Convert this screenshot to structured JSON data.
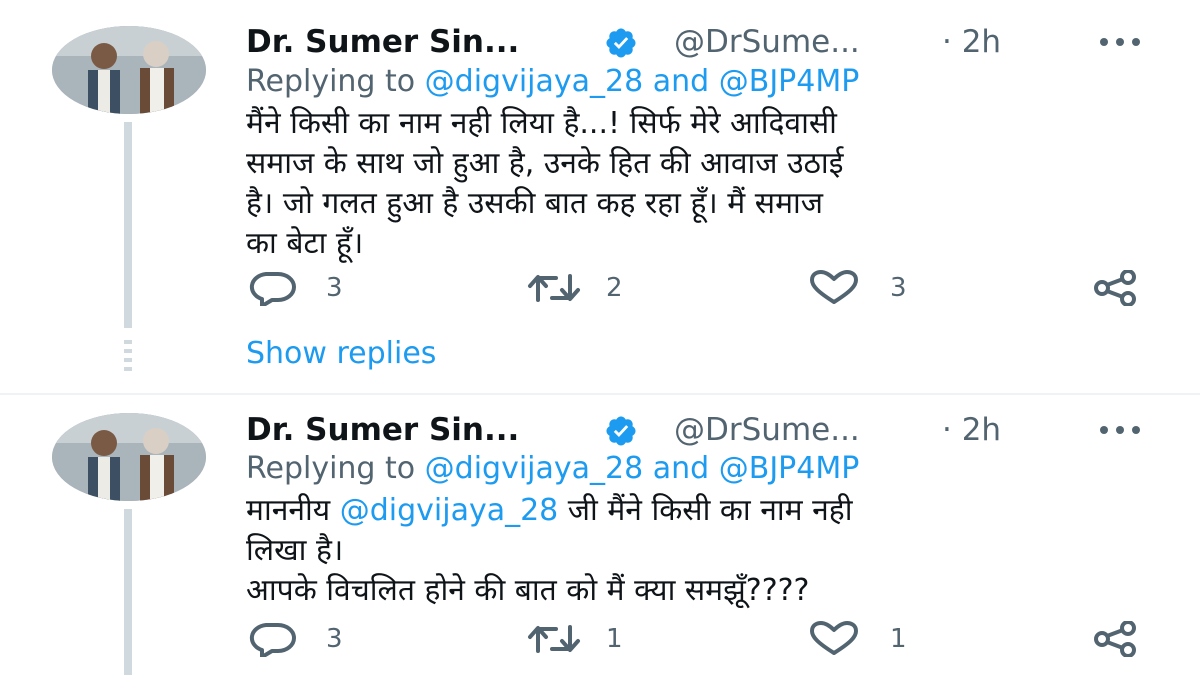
{
  "tweets": [
    {
      "author_name": "Dr. Sumer Sin...",
      "handle": "@DrSume...",
      "time": "· 2h",
      "replying_prefix": "Replying to ",
      "replying_handle_1": "@digvijaya_28",
      "replying_and": " and ",
      "replying_handle_2": "@BJP4MP",
      "text_lines": [
        "मैंने किसी का नाम नही लिया है...! सिर्फ मेरे आदिवासी",
        "समाज के साथ जो हुआ है, उनके हित की आवाज उठाई",
        "है। जो गलत हुआ है उसकी बात कह रहा हूँ। मैं समाज",
        "का बेटा हूँ।"
      ],
      "replies": "3",
      "retweets": "2",
      "likes": "3"
    },
    {
      "author_name": "Dr. Sumer Sin...",
      "handle": "@DrSume...",
      "time": "· 2h",
      "replying_prefix": "Replying to ",
      "replying_handle_1": "@digvijaya_28",
      "replying_and": " and ",
      "replying_handle_2": "@BJP4MP",
      "mention_prefix": "माननीय ",
      "mention": "@digvijaya_28",
      "mention_suffix": " जी  मैंने किसी का नाम नही",
      "text_lines": [
        "लिखा है।",
        "आपके  विचलित होने की बात को मैं क्या समझूँ????"
      ],
      "replies": "3",
      "retweets": "1",
      "likes": "1"
    }
  ],
  "show_replies": "Show replies",
  "colors": {
    "accent": "#1d9bf0",
    "muted": "#536471",
    "text": "#0f1419",
    "thread": "#cfd9de"
  },
  "icons": [
    "verified-badge-icon",
    "more-dots-icon",
    "reply-icon",
    "retweet-icon",
    "like-icon",
    "share-icon"
  ]
}
